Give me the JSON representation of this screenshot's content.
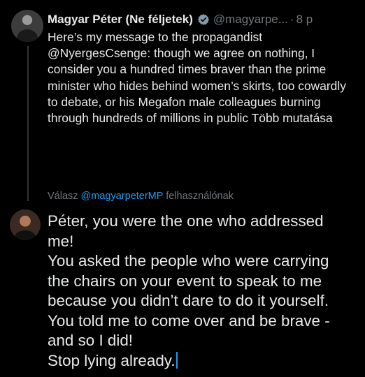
{
  "colors": {
    "background": "#000000",
    "text_primary": "#e7e9ea",
    "text_secondary": "#71767b",
    "link": "#1d9bf0",
    "verified_badge": "#829aab",
    "cursor": "#1d9bf0"
  },
  "tweet": {
    "author_name": "Magyar Péter (Ne féljetek)",
    "verified_icon": "verified-badge-icon",
    "handle": "@magyarpe...",
    "separator": "·",
    "timestamp": "8 p",
    "text": "Here’s my message to the propagandist @NyergesCsenge: though we agree on nothing, I consider you a hundred times braver than the prime minister who hides behind women’s skirts, too cowardly to debate, or his Megafon male colleagues burning through hundreds of millions in public",
    "show_more": "Több mutatása"
  },
  "reply": {
    "prefix": "Válasz",
    "reply_to_handle": "@magyarpeterMP",
    "suffix": "felhasználónak",
    "composer_lines": [
      "Péter, you were the one who addressed",
      "me!",
      "You asked the people who were carrying",
      "the chairs on your event to speak to me",
      "because you didn’t dare to do it yourself.",
      "You told me to come over and be brave -",
      "and so I did!",
      "Stop lying already."
    ]
  }
}
